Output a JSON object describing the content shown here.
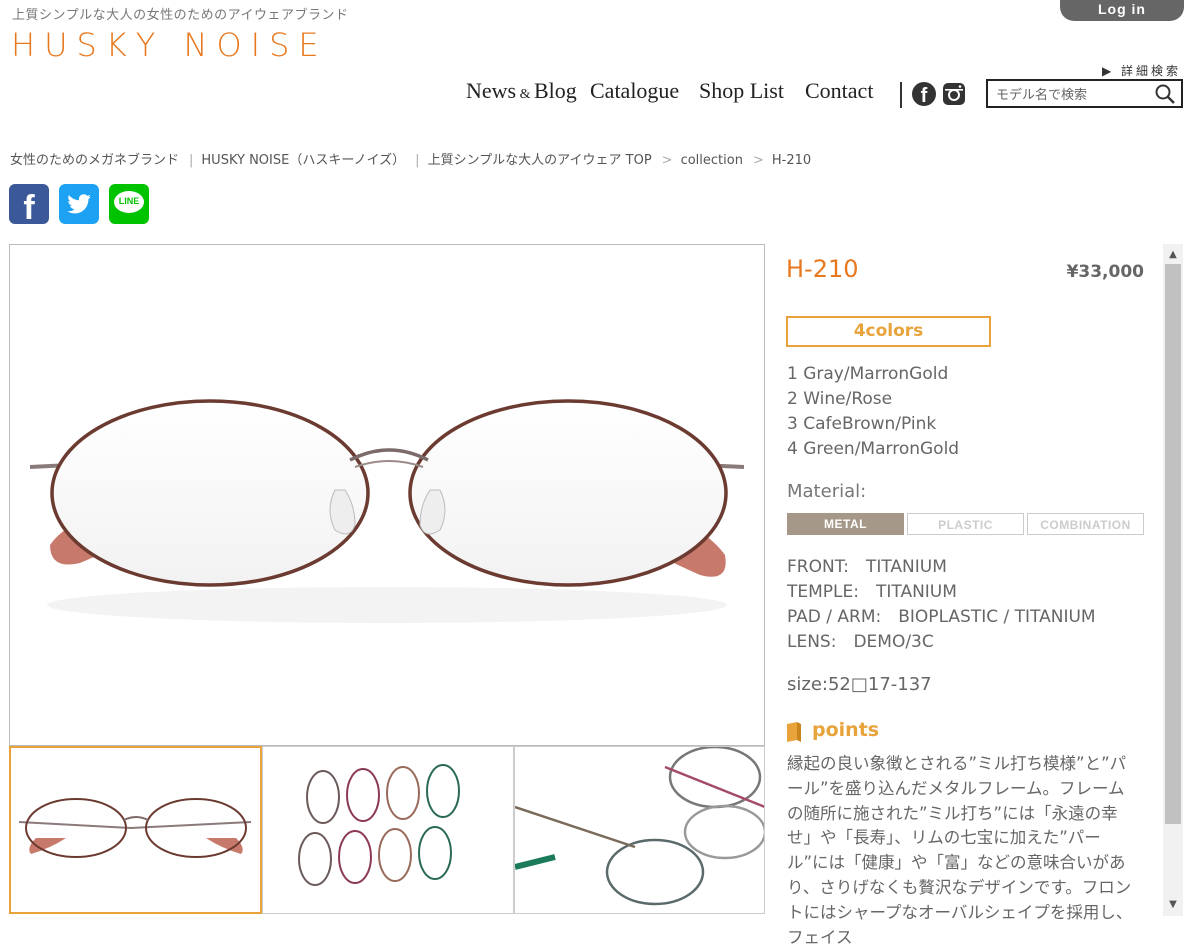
{
  "header": {
    "tagline": "上質シンプルな大人の女性のためのアイウェアブランド",
    "logo": "HUSKY NOISE",
    "login_label": "Log in",
    "advanced_search": "▶ 詳細検索",
    "nav": [
      {
        "main": "News",
        "amp": "&",
        "tail": "Blog"
      },
      {
        "main": "Catalogue"
      },
      {
        "main": "Shop List"
      },
      {
        "main": "Contact"
      }
    ],
    "search_placeholder": "モデル名で検索"
  },
  "breadcrumb": {
    "part1": "女性のためのメガネブランド",
    "part2": "HUSKY NOISE（ハスキーノイズ）",
    "part3": "上質シンプルな大人のアイウェア TOP",
    "part4": "collection",
    "part5": "H-210",
    "divider": "|",
    "arrow": ">"
  },
  "share": {
    "facebook": "f",
    "line": "LINE"
  },
  "product": {
    "model": "H-210",
    "price": "¥33,000",
    "colors_badge": "4colors",
    "colors": [
      "1 Gray/MarronGold",
      "2 Wine/Rose",
      "3 CafeBrown/Pink",
      "4 Green/MarronGold"
    ],
    "material_label": "Material:",
    "materials": [
      {
        "label": "METAL",
        "active": true
      },
      {
        "label": "PLASTIC",
        "active": false
      },
      {
        "label": "COMBINATION",
        "active": false
      }
    ],
    "specs": [
      "FRONT:　TITANIUM",
      "TEMPLE:　TITANIUM",
      "PAD / ARM:　BIOPLASTIC / TITANIUM",
      "LENS:　DEMO/3C"
    ],
    "size": "size:52□17-137",
    "points_label": "points",
    "description": "縁起の良い象徴とされる”ミル打ち模様”と”パール”を盛り込んだメタルフレーム。フレームの随所に施された”ミル打ち”には「永遠の幸せ」や「長寿」、リムの七宝に加えた”パール”には「健康」や「富」などの意味合いがあり、さりげなくも贅沢なデザインです。フロントにはシャープなオーバルシェイプを採用し、フェイス"
  },
  "colors": {
    "accent": "#e8781e",
    "gold": "#e8a33a",
    "metal_active": "#a69888"
  }
}
